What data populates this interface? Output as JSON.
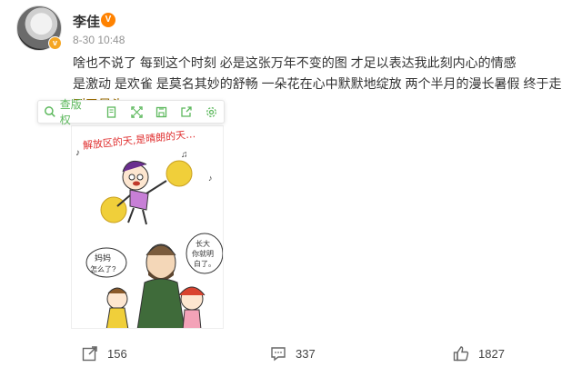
{
  "post": {
    "username": "李佳",
    "vip_badge": "V",
    "verified_mark": "v",
    "time": "8-30 10:48",
    "text_lines": [
      "啥也不说了 每到这个时刻 必是这张万年不变的图 才足以表达我此刻内心的情感",
      "是激动 是欢雀 是莫名其妙的舒畅 一朵花在心中默默地绽放 两个半月的漫长暑假 终于走",
      "到了尽头"
    ]
  },
  "toolbar": {
    "copyright_label": "查版权",
    "icons": [
      "document-icon",
      "expand-icon",
      "save-icon",
      "share-icon",
      "settings-icon"
    ]
  },
  "image": {
    "banner_text": "解放区的天,是晴朗的天…",
    "left_bubble": "妈妈 怎么了?",
    "right_bubble": "长大 你就明 白了。"
  },
  "footer": {
    "repost_count": "156",
    "comment_count": "337",
    "like_count": "1827"
  },
  "colors": {
    "accent_green": "#5cb85c",
    "vip_orange": "#ff8200",
    "verify_gold": "#f5a623"
  }
}
